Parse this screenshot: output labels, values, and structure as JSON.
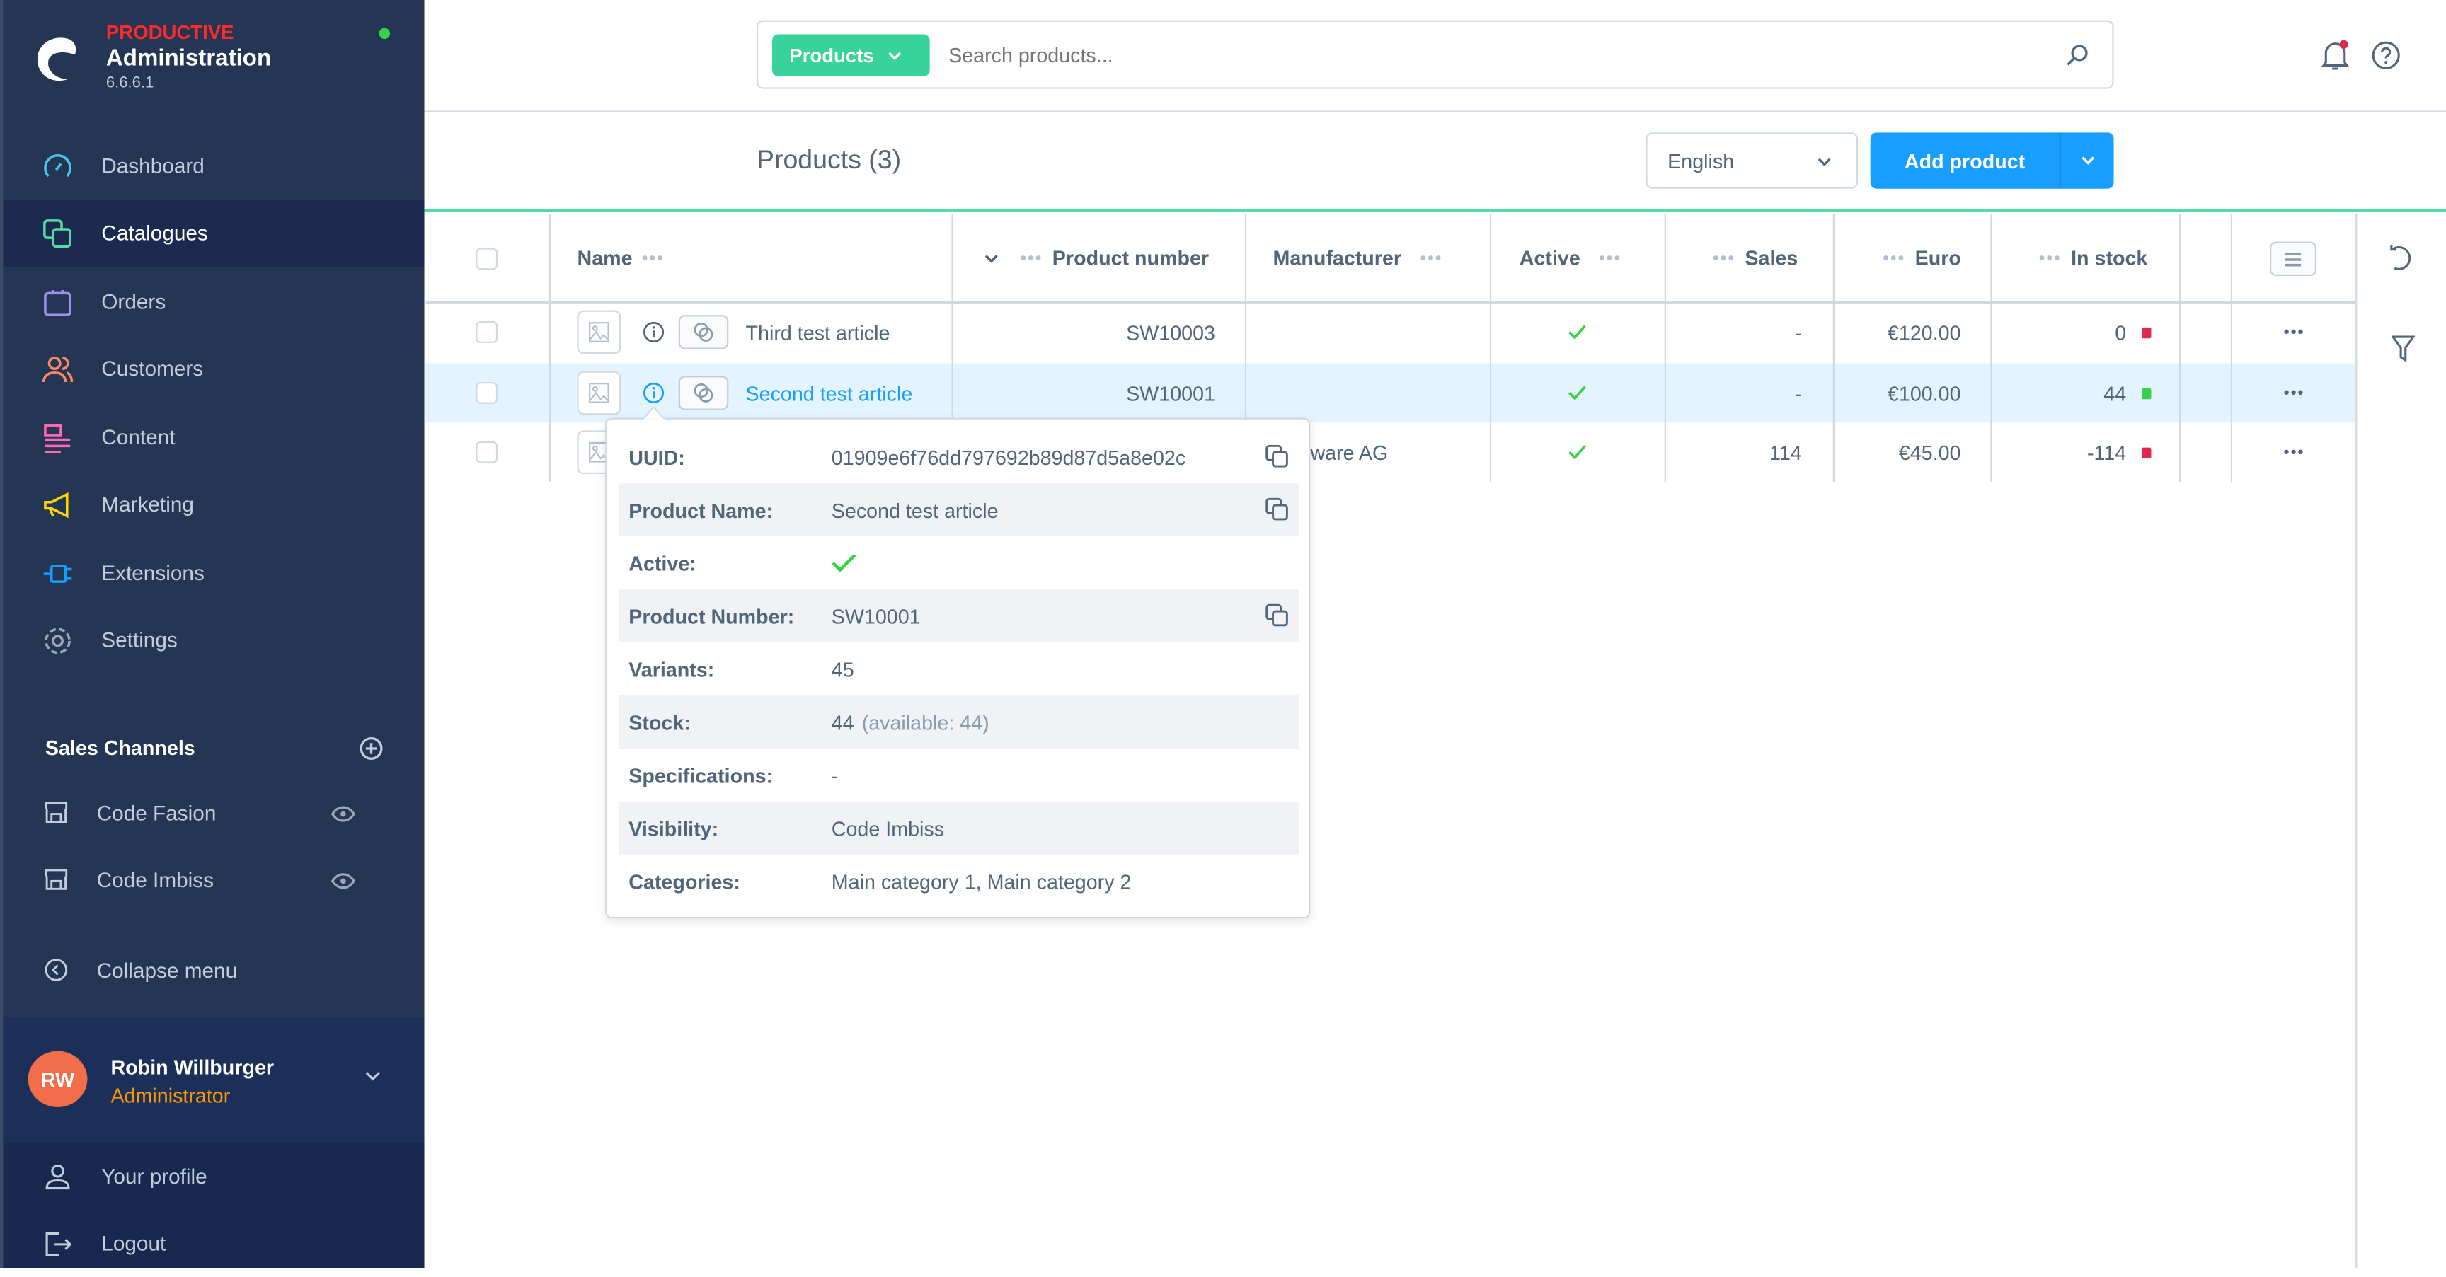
{
  "colors": {
    "sidebar": "#253655",
    "accent_green": "#37d39b",
    "brand_blue": "#189eff",
    "danger": "#de294c",
    "success": "#37d046",
    "environment": "#ff2a2a",
    "role": "#ff9800",
    "avatar": "#f26e4a"
  },
  "sidebar": {
    "environment": "PRODUCTIVE",
    "title": "Administration",
    "version": "6.6.6.1",
    "status": "online",
    "items": [
      {
        "label": "Dashboard",
        "icon": "gauge-icon"
      },
      {
        "label": "Catalogues",
        "icon": "catalogue-icon",
        "active": true
      },
      {
        "label": "Orders",
        "icon": "shopping-bag-icon"
      },
      {
        "label": "Customers",
        "icon": "users-icon"
      },
      {
        "label": "Content",
        "icon": "content-icon"
      },
      {
        "label": "Marketing",
        "icon": "megaphone-icon"
      },
      {
        "label": "Extensions",
        "icon": "plug-icon"
      },
      {
        "label": "Settings",
        "icon": "gear-icon"
      }
    ],
    "sales_channels_title": "Sales Channels",
    "sales_channels": [
      {
        "label": "Code Fasion"
      },
      {
        "label": "Code Imbiss"
      }
    ],
    "collapse": "Collapse menu",
    "user": {
      "initials": "RW",
      "name": "Robin Willburger",
      "role": "Administrator"
    },
    "profile": "Your profile",
    "logout": "Logout"
  },
  "search": {
    "type": "Products",
    "placeholder": "Search products..."
  },
  "header": {
    "title": "Products (3)",
    "language": "English",
    "add": "Add product"
  },
  "table": {
    "columns": [
      "Name",
      "Product number",
      "Manufacturer",
      "Active",
      "Sales",
      "Euro",
      "In stock"
    ],
    "rows": [
      {
        "name": "Third test article",
        "number": "SW10003",
        "manufacturer": "",
        "active": true,
        "sales": "-",
        "price": "€120.00",
        "stock": "0",
        "stock_status": "danger"
      },
      {
        "name": "Second test article",
        "number": "SW10001",
        "manufacturer": "",
        "active": true,
        "sales": "-",
        "price": "€100.00",
        "stock": "44",
        "stock_status": "success",
        "highlighted": true
      },
      {
        "name": "",
        "number": "",
        "manufacturer": "ware AG",
        "active": true,
        "sales": "114",
        "price": "€45.00",
        "stock": "-114",
        "stock_status": "danger"
      }
    ]
  },
  "popover": {
    "uuid_label": "UUID:",
    "uuid": "01909e6f76dd797692b89d87d5a8e02c",
    "name_label": "Product Name:",
    "name": "Second test article",
    "active_label": "Active:",
    "number_label": "Product Number:",
    "number": "SW10001",
    "variants_label": "Variants:",
    "variants": "45",
    "stock_label": "Stock:",
    "stock": "44",
    "stock_available": "(available: 44)",
    "spec_label": "Specifications:",
    "spec": "-",
    "visibility_label": "Visibility:",
    "visibility": "Code Imbiss",
    "categories_label": "Categories:",
    "categories": "Main category 1, Main category 2"
  }
}
